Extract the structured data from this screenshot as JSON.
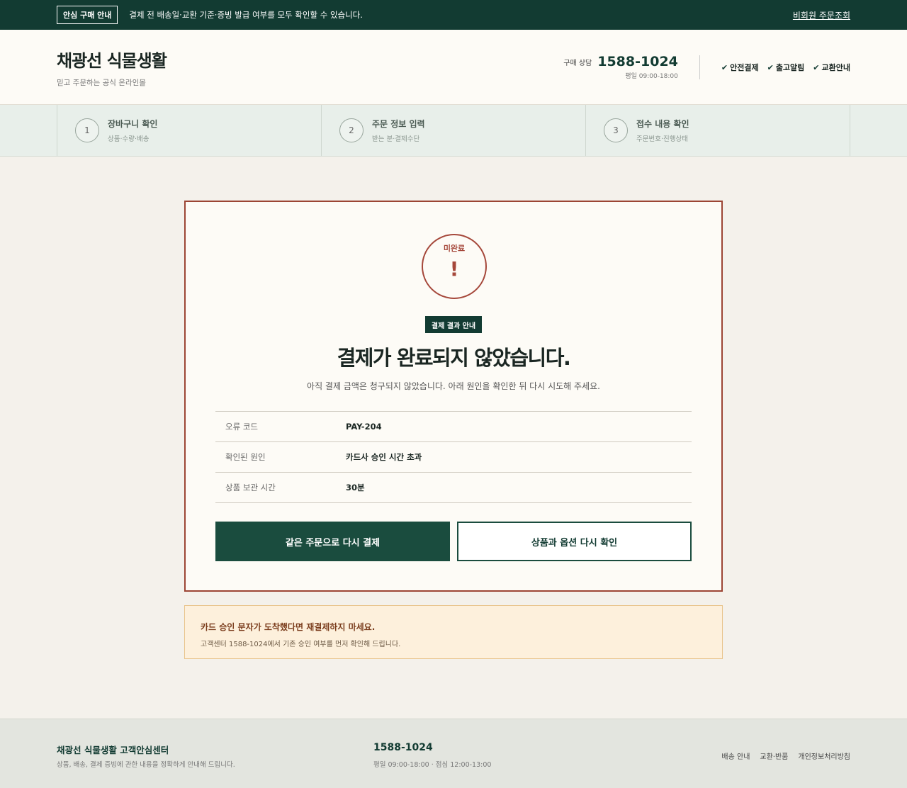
{
  "topbar": {
    "chip": "안심 구매 안내",
    "note": "결제 전 배송일·교환 기준·증빙 발급 여부를 모두 확인할 수 있습니다.",
    "link": "비회원 주문조회"
  },
  "header": {
    "brand": "채광선 식물생활",
    "tagline": "믿고 주문하는 공식 온라인몰",
    "contact_label": "구매 상담",
    "contact_number": "1588-1024",
    "contact_hours": "평일 09:00-18:00",
    "assurances": [
      "안전결제",
      "출고알림",
      "교환안내"
    ]
  },
  "steps": [
    {
      "num": "1",
      "title": "장바구니 확인",
      "desc": "상품·수량·배송"
    },
    {
      "num": "2",
      "title": "주문 정보 입력",
      "desc": "받는 분·결제수단"
    },
    {
      "num": "3",
      "title": "접수 내용 확인",
      "desc": "주문번호·진행상태"
    }
  ],
  "result": {
    "status": "미완료",
    "status_mark": "!",
    "tag": "결제 결과 안내",
    "headline": "결제가 완료되지 않았습니다.",
    "subline": "아직 결제 금액은 청구되지 않았습니다. 아래 원인을 확인한 뒤 다시 시도해 주세요.",
    "details": [
      {
        "label": "오류 코드",
        "value": "PAY-204"
      },
      {
        "label": "확인된 원인",
        "value": "카드사 승인 시간 초과"
      },
      {
        "label": "상품 보관 시간",
        "value": "30분"
      }
    ],
    "primary_button": "같은 주문으로 다시 결제",
    "secondary_button": "상품과 옵션 다시 확인"
  },
  "notice": {
    "title": "카드 승인 문자가 도착했다면 재결제하지 마세요.",
    "body": "고객센터 1588-1024에서 기존 승인 여부를 먼저 확인해 드립니다."
  },
  "footer": {
    "name": "채광선 식물생활 고객안심센터",
    "desc": "상품, 배송, 결제 증빙에 관한 내용을 정확하게 안내해 드립니다.",
    "phone": "1588-1024",
    "hours": "평일 09:00-18:00 · 점심 12:00-13:00",
    "links": [
      "배송 안내",
      "교환·반품",
      "개인정보처리방침"
    ]
  },
  "colors": {
    "brand": "#123b32",
    "error": "#a5473a",
    "notice_bg": "#fdf0dc"
  }
}
